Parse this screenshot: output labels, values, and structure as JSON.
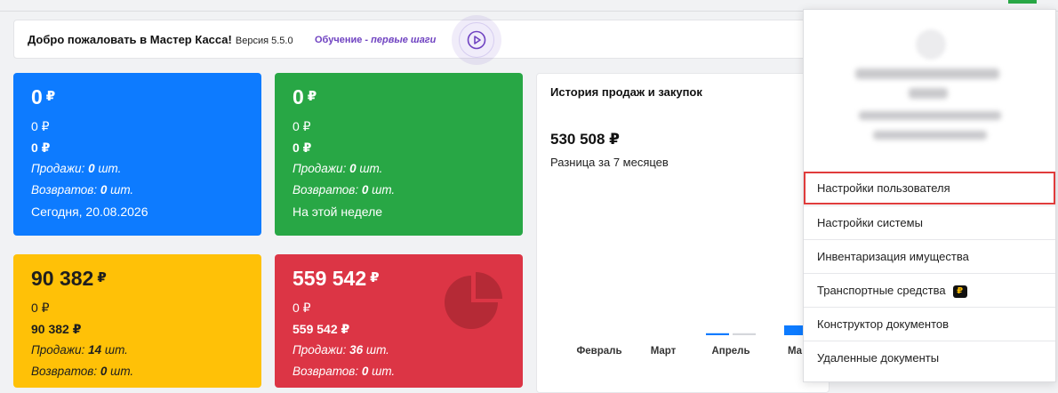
{
  "welcome": {
    "title": "Добро пожаловать в Мастер Касса!",
    "version": "Версия 5.5.0",
    "learn_prefix": "Обучение - ",
    "learn_link": "первые шаги"
  },
  "cards": {
    "blue": {
      "big": "0",
      "currency": "₽",
      "line1": "0 ₽",
      "line2": "0 ₽",
      "sales_label": "Продажи: ",
      "sales_count": "0",
      "sales_unit": " шт.",
      "returns_label": "Возвратов: ",
      "returns_count": "0",
      "returns_unit": " шт.",
      "footer": "Сегодня, 20.08.2026"
    },
    "green": {
      "big": "0",
      "currency": "₽",
      "line1": "0 ₽",
      "line2": "0 ₽",
      "sales_label": "Продажи: ",
      "sales_count": "0",
      "sales_unit": " шт.",
      "returns_label": "Возвратов: ",
      "returns_count": "0",
      "returns_unit": " шт.",
      "footer": "На этой неделе"
    },
    "yellow": {
      "big": "90 382",
      "currency": "₽",
      "line1": "0 ₽",
      "line2": "90 382 ₽",
      "sales_label": "Продажи: ",
      "sales_count": "14",
      "sales_unit": " шт.",
      "returns_label": "Возвратов: ",
      "returns_count": "0",
      "returns_unit": " шт."
    },
    "red": {
      "big": "559 542",
      "currency": "₽",
      "line1": "0 ₽",
      "line2": "559 542 ₽",
      "sales_label": "Продажи: ",
      "sales_count": "36",
      "sales_unit": " шт.",
      "returns_label": "Возвратов: ",
      "returns_count": "0",
      "returns_unit": " шт.",
      "icon": "pie-chart-icon"
    }
  },
  "chart": {
    "title": "История продаж и закупок",
    "value": "530 508 ₽",
    "subtitle": "Разница за 7 месяцев",
    "months": [
      "Февраль",
      "Март",
      "Апрель",
      "Ма"
    ]
  },
  "chart_data": {
    "type": "bar",
    "categories": [
      "Февраль",
      "Март",
      "Апрель",
      "Ма"
    ],
    "series": [
      {
        "values": [
          0,
          0,
          1,
          5
        ],
        "color": "#0d7bff"
      },
      {
        "values": [
          0,
          0,
          1,
          0
        ],
        "color": "#d5d7db"
      }
    ]
  },
  "menu": {
    "items": [
      "Настройки пользователя",
      "Настройки системы",
      "Инвентаризация имущества",
      "Транспортные средства",
      "Конструктор документов",
      "Удаленные документы"
    ],
    "badge": "₽"
  },
  "colors": {
    "accent": "#6f42c1",
    "blue": "#0d7bff",
    "green": "#28a745",
    "yellow": "#ffc107",
    "red": "#dc3545",
    "highlight": "#e03c3c"
  }
}
